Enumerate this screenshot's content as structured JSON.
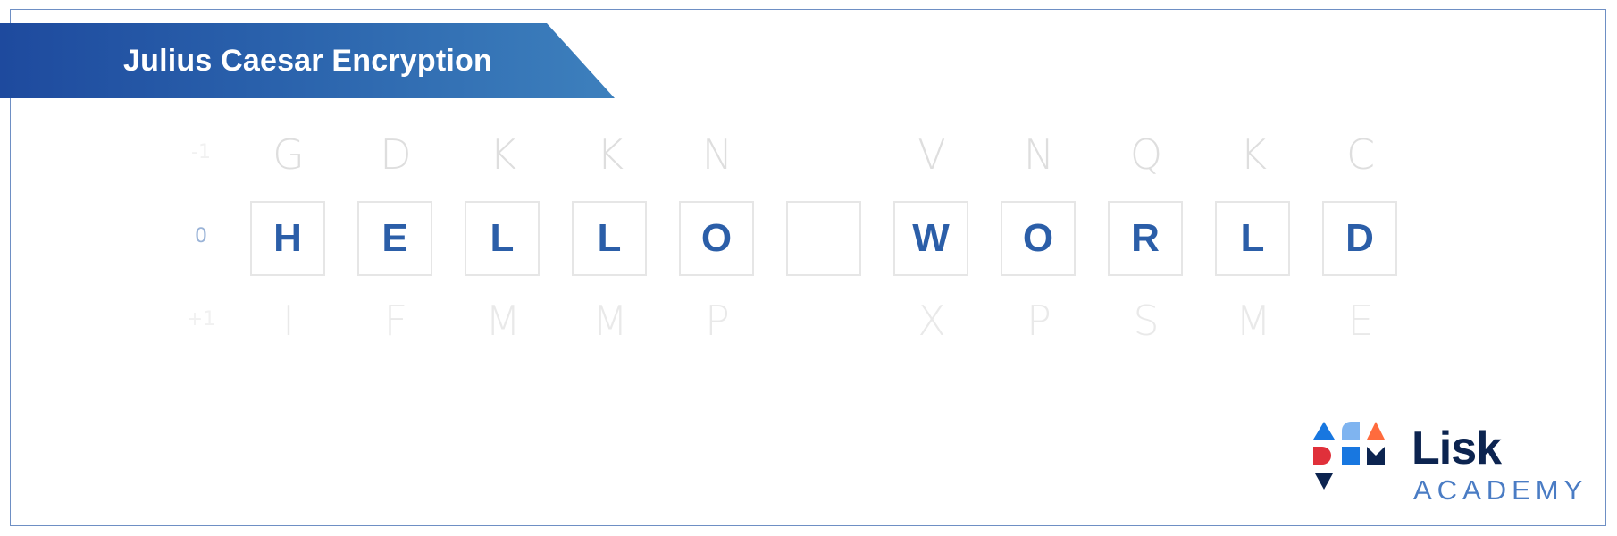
{
  "header": {
    "title": "Julius Caesar Encryption"
  },
  "row_labels": {
    "top": "-1",
    "middle": "0",
    "bottom": "+1"
  },
  "columns": [
    {
      "up": "G",
      "plain": "H",
      "down": "I"
    },
    {
      "up": "D",
      "plain": "E",
      "down": "F"
    },
    {
      "up": "K",
      "plain": "L",
      "down": "M"
    },
    {
      "up": "K",
      "plain": "L",
      "down": "M"
    },
    {
      "up": "N",
      "plain": "O",
      "down": "P"
    },
    {
      "up": "",
      "plain": "",
      "down": ""
    },
    {
      "up": "V",
      "plain": "W",
      "down": "X"
    },
    {
      "up": "N",
      "plain": "O",
      "down": "P"
    },
    {
      "up": "Q",
      "plain": "R",
      "down": "S"
    },
    {
      "up": "K",
      "plain": "L",
      "down": "M"
    },
    {
      "up": "C",
      "plain": "D",
      "down": "E"
    }
  ],
  "brand": {
    "name": "Lisk",
    "sub": "ACADEMY"
  },
  "colors": {
    "banner_start": "#1e4a9e",
    "banner_end": "#3d80bd",
    "letter": "#2b5ea8",
    "logo_blue": "#1877e0",
    "logo_light_blue": "#7fb4f0",
    "logo_orange": "#ff6b3d",
    "logo_red": "#e0303a",
    "logo_navy": "#0c2450"
  }
}
